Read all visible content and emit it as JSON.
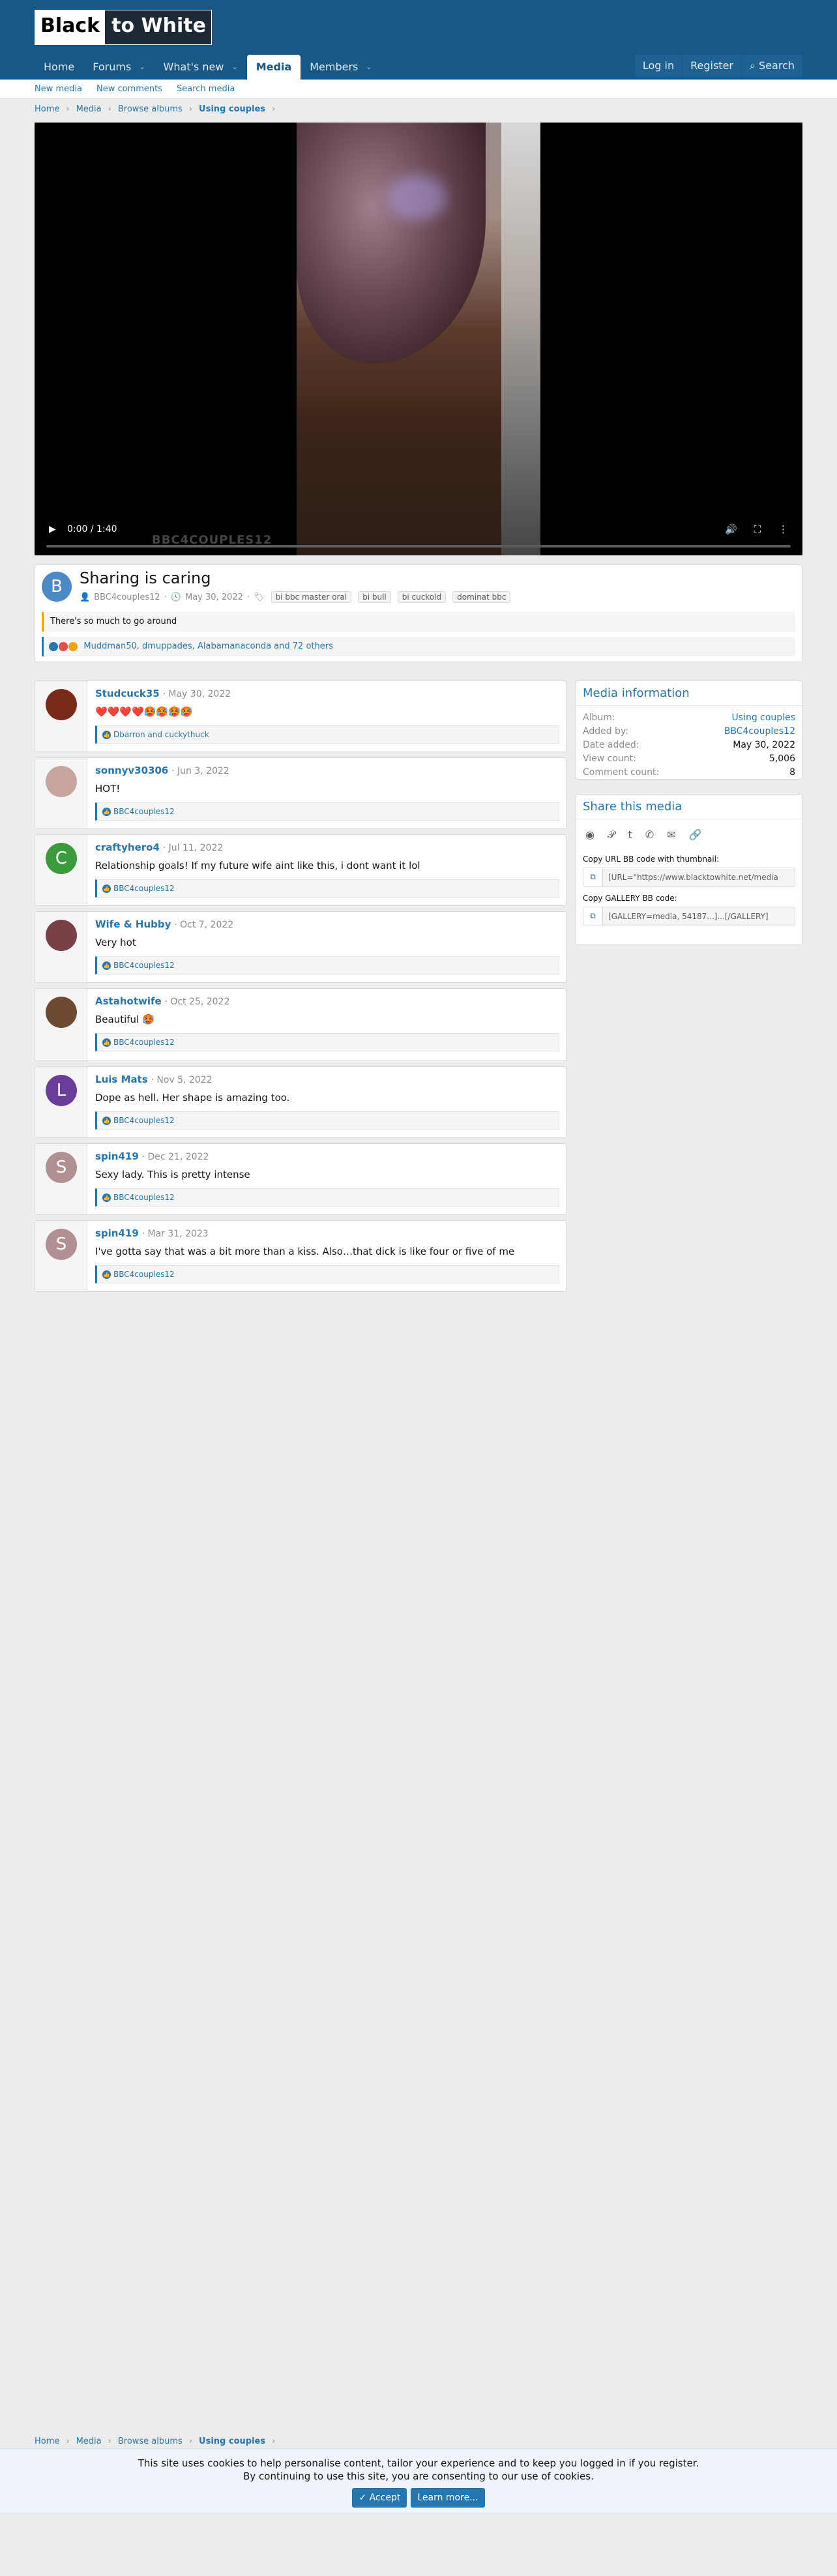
{
  "header": {
    "logo_left": "Black",
    "logo_right": "to White",
    "nav": [
      {
        "label": "Home"
      },
      {
        "label": "Forums"
      },
      {
        "label": "What's new"
      },
      {
        "label": "Media"
      },
      {
        "label": "Members"
      }
    ],
    "login": "Log in",
    "register": "Register",
    "search": "Search"
  },
  "subnav": [
    "New media",
    "New comments",
    "Search media"
  ],
  "breadcrumb": [
    "Home",
    "Media",
    "Browse albums",
    "Using couples"
  ],
  "video": {
    "time": "0:00 / 1:40",
    "watermark": "BBC4COUPLES12"
  },
  "media": {
    "avatar_letter": "B",
    "title": "Sharing is caring",
    "author": "BBC4couples12",
    "date": "May 30, 2022",
    "tags": [
      "bi bbc master oral",
      "bi bull",
      "bi cuckold",
      "dominat bbc"
    ],
    "description": "There's so much to go around",
    "reactions": "Muddman50, dmuppades, Alabamanaconda and 72 others"
  },
  "comments": [
    {
      "name": "Studcuck35",
      "date": "May 30, 2022",
      "text": "❤️❤️❤️❤️🥵🥵🥵🥵",
      "reactions": "Dbarron and cuckythuck",
      "avatar_color": "#7a2a18",
      "letter": ""
    },
    {
      "name": "sonnyv30306",
      "date": "Jun 3, 2022",
      "text": "HOT!",
      "reactions": "BBC4couples12",
      "avatar_color": "#c8a4a0",
      "letter": ""
    },
    {
      "name": "craftyhero4",
      "date": "Jul 11, 2022",
      "text": "Relationship goals! If my future wife aint like this, i dont want it lol",
      "reactions": "BBC4couples12",
      "avatar_color": "#3b9a3b",
      "letter": "C"
    },
    {
      "name": "Wife & Hubby",
      "date": "Oct 7, 2022",
      "text": "Very hot",
      "reactions": "BBC4couples12",
      "avatar_color": "#7a4048",
      "letter": ""
    },
    {
      "name": "Astahotwife",
      "date": "Oct 25, 2022",
      "text": "Beautiful 🥵",
      "reactions": "BBC4couples12",
      "avatar_color": "#6e4a32",
      "letter": ""
    },
    {
      "name": "Luis Mats",
      "date": "Nov 5, 2022",
      "text": "Dope as hell. Her shape is amazing too.",
      "reactions": "BBC4couples12",
      "avatar_color": "#6a3d9a",
      "letter": "L"
    },
    {
      "name": "spin419",
      "date": "Dec 21, 2022",
      "text": "Sexy lady. This is pretty intense",
      "reactions": "BBC4couples12",
      "avatar_color": "#b09090",
      "letter": "S"
    },
    {
      "name": "spin419",
      "date": "Mar 31, 2023",
      "text": "I've gotta say that was a bit more than a kiss. Also…that dick is like four or five of me",
      "reactions": "BBC4couples12",
      "avatar_color": "#b09090",
      "letter": "S"
    }
  ],
  "info": {
    "title": "Media information",
    "album_label": "Album:",
    "album": "Using couples",
    "added_label": "Added by:",
    "added": "BBC4couples12",
    "date_label": "Date added:",
    "date": "May 30, 2022",
    "views_label": "View count:",
    "views": "5,006",
    "comments_label": "Comment count:",
    "comments": "8"
  },
  "share": {
    "title": "Share this media",
    "url_label": "Copy URL BB code with thumbnail:",
    "url_value": "[URL=\"https://www.blacktowhite.net/media",
    "gallery_label": "Copy GALLERY BB code:",
    "gallery_value": "[GALLERY=media, 54187...]...[/GALLERY]"
  },
  "cookie": {
    "line1": "This site uses cookies to help personalise content, tailor your experience and to keep you logged in if you register.",
    "line2": "By continuing to use this site, you are consenting to our use of cookies.",
    "accept": "Accept",
    "learn": "Learn more..."
  }
}
